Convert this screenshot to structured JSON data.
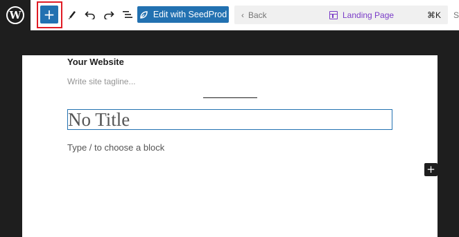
{
  "toolbar": {
    "logo_letter": "W",
    "add_symbol": "+",
    "seedprod_label": "Edit with SeedProd",
    "back_label": "Back",
    "back_chevron": "‹",
    "document_title": "Landing Page",
    "shortcut": "⌘K",
    "edge_text": "S",
    "icons": [
      "wordpress-logo",
      "plus-icon",
      "pen-icon",
      "undo-icon",
      "redo-icon",
      "list-view-icon",
      "leaf-icon",
      "layout-icon"
    ]
  },
  "canvas": {
    "site_title": "Your Website",
    "tagline": "Write site tagline...",
    "post_title": "No Title",
    "block_placeholder": "Type / to choose a block",
    "inserter_symbol": "+"
  },
  "colors": {
    "accent": "#2271b1",
    "dark": "#1e1e1e",
    "highlight": "#e01b24",
    "template_purple": "#7a3cc7"
  }
}
